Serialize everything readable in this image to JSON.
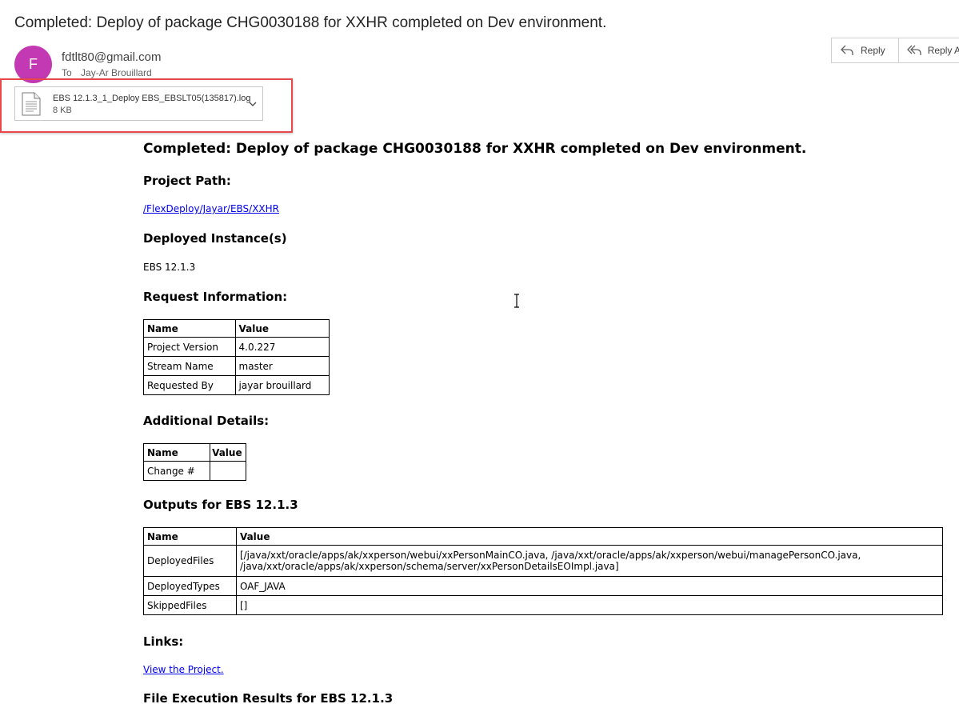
{
  "email": {
    "subject": "Completed: Deploy of package CHG0030188 for XXHR completed on Dev environment.",
    "avatar_initial": "F",
    "avatar_color": "#c239b3",
    "sender": "fdtlt80@gmail.com",
    "to_label": "To",
    "recipient": "Jay-Ar Brouillard"
  },
  "actions": {
    "reply_label": "Reply",
    "reply_all_label": "Reply Al"
  },
  "attachment": {
    "file_name": "EBS 12.1.3_1_Deploy EBS_EBSLT05(135817).log",
    "file_size": "8 KB",
    "highlight_color": "#e8474c"
  },
  "body": {
    "title": "Completed: Deploy of package CHG0030188 for XXHR completed on Dev environment.",
    "project_path_heading": "Project Path:",
    "project_path_link": "/FlexDeploy/Jayar/EBS/XXHR",
    "deployed_instances_heading": "Deployed Instance(s)",
    "deployed_instance": "EBS 12.1.3",
    "request_info_heading": "Request Information:",
    "request_info_table": {
      "headers": [
        "Name",
        "Value"
      ],
      "rows": [
        [
          "Project Version",
          "4.0.227"
        ],
        [
          "Stream Name",
          "master"
        ],
        [
          "Requested By",
          "jayar brouillard"
        ]
      ]
    },
    "additional_details_heading": "Additional Details:",
    "additional_details_table": {
      "headers": [
        "Name",
        "Value"
      ],
      "rows": [
        [
          "Change #",
          ""
        ]
      ]
    },
    "outputs_heading": "Outputs for EBS 12.1.3",
    "outputs_table": {
      "headers": [
        "Name",
        "Value"
      ],
      "rows": [
        [
          "DeployedFiles",
          "[/java/xxt/oracle/apps/ak/xxperson/webui/xxPersonMainCO.java, /java/xxt/oracle/apps/ak/xxperson/webui/managePersonCO.java,",
          "/java/xxt/oracle/apps/ak/xxperson/schema/server/xxPersonDetailsEOImpl.java]"
        ],
        [
          "DeployedTypes",
          "OAF_JAVA"
        ],
        [
          "SkippedFiles",
          "[]"
        ]
      ]
    },
    "links_heading": "Links:",
    "view_project_link": "View the Project.",
    "file_execution_heading": "File Execution Results for EBS 12.1.3"
  }
}
